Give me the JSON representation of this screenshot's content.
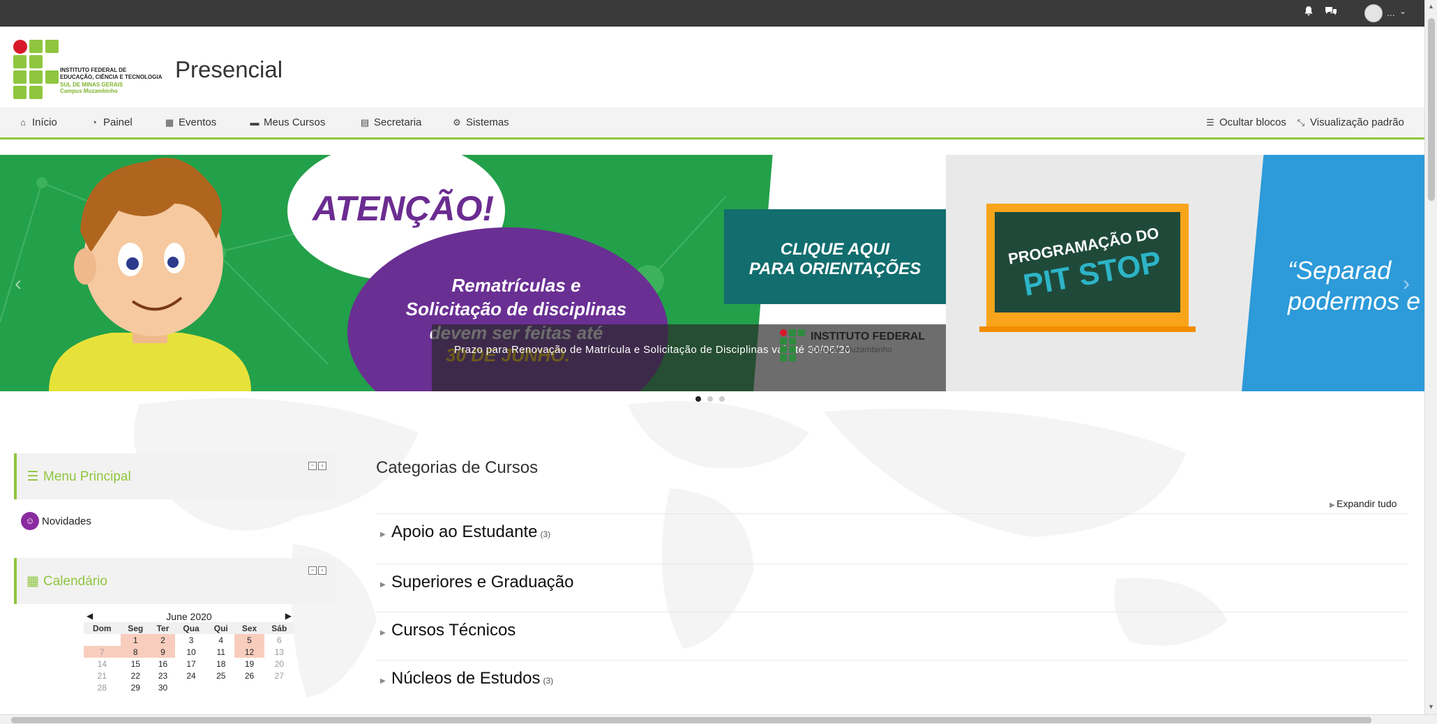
{
  "topbar": {
    "notifications_icon": "bell-icon",
    "messages_icon": "chat-icon",
    "user_name": "...",
    "user_menu_icon": "chevron-down-icon"
  },
  "header": {
    "logo": {
      "line1": "INSTITUTO FEDERAL DE",
      "line2": "EDUCAÇÃO, CIÊNCIA E TECNOLOGIA",
      "line3": "SUL DE MINAS GERAIS",
      "line4": "Campus Muzambinho"
    },
    "site_title": "Presencial"
  },
  "nav": {
    "items": [
      {
        "label": "Início",
        "icon": "home-icon"
      },
      {
        "label": "Painel",
        "icon": "dashboard-icon"
      },
      {
        "label": "Eventos",
        "icon": "calendar-icon"
      },
      {
        "label": "Meus Cursos",
        "icon": "briefcase-icon"
      },
      {
        "label": "Secretaria",
        "icon": "archive-icon"
      },
      {
        "label": "Sistemas",
        "icon": "cogs-icon"
      }
    ],
    "hide_blocks": "Ocultar blocos",
    "default_view": "Visualização padrão"
  },
  "slider": {
    "slide1": {
      "heading": "ATENÇÃO!",
      "body_line1": "Rematrículas e",
      "body_line2": "Solicitação de disciplinas",
      "body_line3": "devem ser feitas até",
      "deadline": "30 DE JUNHO.",
      "cta_line1": "CLIQUE AQUI",
      "cta_line2": "PARA ORIENTAÇÕES",
      "inst_name": "INSTITUTO FEDERAL",
      "inst_campus": "Campus Muzambinho",
      "caption": "Prazo para Renovação de Matrícula e Solicitação de Disciplinas vai até 30/06/20"
    },
    "slide2": {
      "board_line1": "PROGRAMAÇÃO DO",
      "board_line2": "PIT STOP",
      "quote_line1": "“Separad",
      "quote_line2": "podermos e"
    },
    "total_slides": 3,
    "active_slide": 1
  },
  "blocks": {
    "menu": {
      "title": "Menu Principal",
      "items": [
        {
          "label": "Novidades",
          "icon": "forum-icon"
        }
      ]
    },
    "calendar": {
      "title": "Calendário",
      "month": "June 2020",
      "prev": "◀",
      "next": "▶",
      "weekdays": [
        "Dom",
        "Seg",
        "Ter",
        "Qua",
        "Qui",
        "Sex",
        "Sáb"
      ],
      "weeks": [
        [
          "",
          "1",
          "2",
          "3",
          "4",
          "5",
          "6"
        ],
        [
          "7",
          "8",
          "9",
          "10",
          "11",
          "12",
          "13"
        ],
        [
          "14",
          "15",
          "16",
          "17",
          "18",
          "19",
          "20"
        ],
        [
          "21",
          "22",
          "23",
          "24",
          "25",
          "26",
          "27"
        ],
        [
          "28",
          "29",
          "30",
          "",
          "",
          "",
          ""
        ]
      ],
      "event_days": [
        "1",
        "2",
        "5",
        "7",
        "8",
        "9",
        "12"
      ]
    }
  },
  "main": {
    "title": "Categorias de Cursos",
    "expand_all": "Expandir tudo",
    "categories": [
      {
        "name": "Apoio ao Estudante",
        "count": "(3)"
      },
      {
        "name": "Superiores e Graduação",
        "count": ""
      },
      {
        "name": "Cursos Técnicos",
        "count": ""
      },
      {
        "name": "Núcleos de Estudos",
        "count": "(3)"
      }
    ]
  }
}
